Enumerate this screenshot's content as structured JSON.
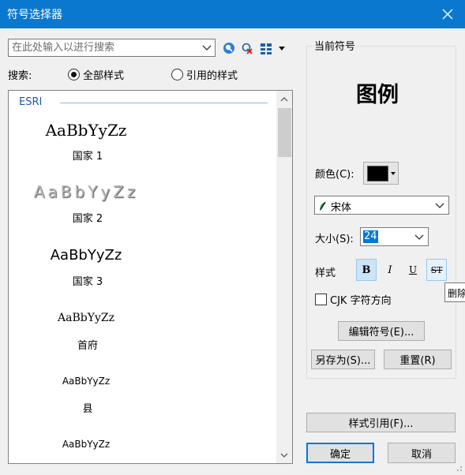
{
  "window": {
    "title": "符号选择器"
  },
  "search": {
    "placeholder": "在此处输入以进行搜索"
  },
  "search_scope": {
    "label": "搜索:",
    "options": [
      "全部样式",
      "引用的样式"
    ],
    "selected": "全部样式"
  },
  "symbol_list": {
    "group": "ESRI",
    "items": [
      {
        "sample": "AaBbYyZz",
        "name": "国家 1"
      },
      {
        "sample": "AaBbYyZz",
        "name": "国家 2"
      },
      {
        "sample": "AaBbYyZz",
        "name": "国家 3"
      },
      {
        "sample": "AaBbYyZz",
        "name": "首府"
      },
      {
        "sample": "AaBbYyZz",
        "name": "县"
      },
      {
        "sample": "AaBbYyZz",
        "name": ""
      }
    ]
  },
  "current": {
    "group_label": "当前符号",
    "preview_text": "图例",
    "color_label": "颜色(C):",
    "color": "#000000",
    "font": "宋体",
    "size_label": "大小(S):",
    "size": "24",
    "style_label": "样式",
    "style_buttons": [
      "B",
      "I",
      "U",
      "ST"
    ],
    "cjk_label": "CJK 字符方向",
    "edit_button": "编辑符号(E)...",
    "save_as_button": "另存为(S)...",
    "reset_button": "重置(R)"
  },
  "tooltip": "删除",
  "footer": {
    "style_ref_button": "样式引用(F)...",
    "ok_button": "确定",
    "cancel_button": "取消"
  },
  "colors": {
    "title_bar": "#0b78d0",
    "accent": "#0078d7",
    "group_header": "#1c5aa8"
  }
}
